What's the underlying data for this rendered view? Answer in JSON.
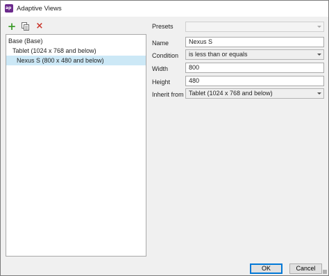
{
  "window": {
    "title": "Adaptive Views",
    "icon": "axure-app-icon",
    "icon_text": "ap",
    "accent_color": "#6b2a8c"
  },
  "toolbar": {
    "buttons": [
      {
        "name": "add-view-button",
        "icon": "plus-icon",
        "glyph": "+"
      },
      {
        "name": "duplicate-view-button",
        "icon": "copy-icon",
        "glyph": ""
      },
      {
        "name": "delete-view-button",
        "icon": "close-icon",
        "glyph": "×"
      }
    ]
  },
  "tree": {
    "items": [
      {
        "label": "Base (Base)",
        "level": 0,
        "selected": false
      },
      {
        "label": "Tablet (1024 x 768 and below)",
        "level": 1,
        "selected": false
      },
      {
        "label": "Nexus S (800 x 480 and below)",
        "level": 2,
        "selected": true
      }
    ],
    "selection_color": "#cce8f6"
  },
  "form": {
    "presets": {
      "label": "Presets",
      "value": ""
    },
    "name": {
      "label": "Name",
      "value": "Nexus S"
    },
    "condition": {
      "label": "Condition",
      "value": "is less than or equals"
    },
    "width": {
      "label": "Width",
      "value": "800"
    },
    "height": {
      "label": "Height",
      "value": "480"
    },
    "inherit_from": {
      "label": "Inherit from",
      "value": "Tablet (1024 x 768 and below)"
    }
  },
  "buttons": {
    "ok": "OK",
    "cancel": "Cancel"
  }
}
